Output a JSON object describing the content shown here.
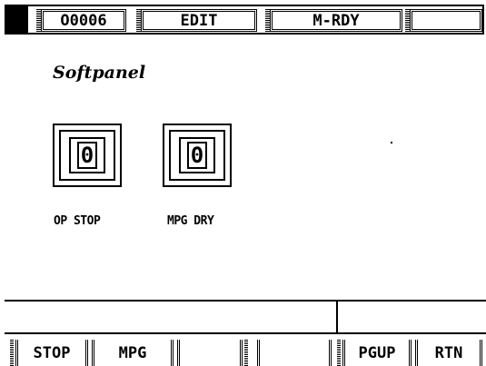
{
  "status_bar": {
    "program_number": "O0006",
    "mode": "EDIT",
    "machine_status": "M-RDY",
    "extra": ""
  },
  "softpanel": {
    "title": "Softpanel",
    "switches": [
      {
        "label": "OP STOP",
        "value": "0"
      },
      {
        "label": "MPG DRY",
        "value": "0"
      }
    ]
  },
  "input_line": {
    "left": "",
    "right": ""
  },
  "softkeys": [
    "STOP",
    "MPG",
    "",
    "",
    "PGUP",
    "RTN"
  ]
}
